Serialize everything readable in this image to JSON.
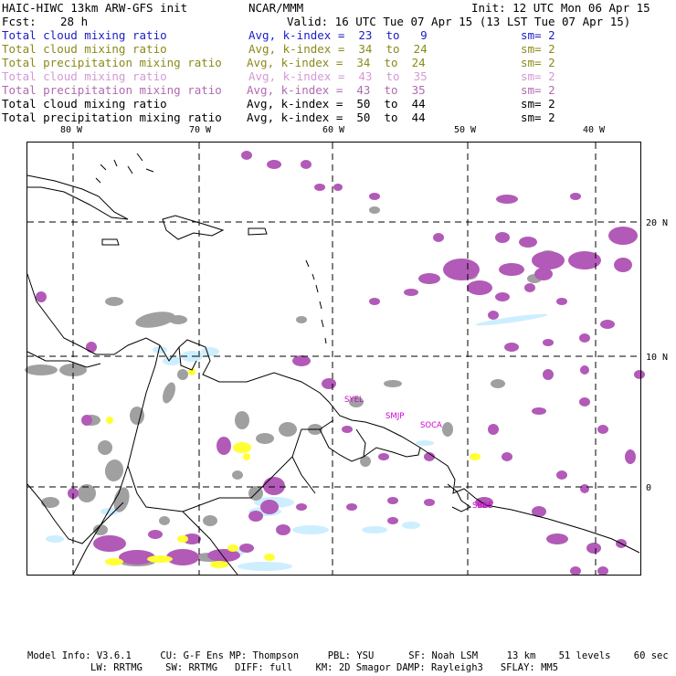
{
  "header": {
    "model": "HAIC-HIWC 13km ARW-GFS init",
    "org": "NCAR/MMM",
    "init": "Init: 12 UTC Mon 06 Apr 15",
    "fcst_label": "Fcst:",
    "fcst_value": "28 h",
    "valid": "Valid: 16 UTC Tue 07 Apr 15 (13 LST Tue 07 Apr 15)"
  },
  "fields": [
    {
      "name": "Total cloud mixing ratio",
      "avg": "Avg, k-index =  23  to   9",
      "sm": "sm= 2",
      "color": "#1c1cc8"
    },
    {
      "name": "Total cloud mixing ratio",
      "avg": "Avg, k-index =  34  to  24",
      "sm": "sm= 2",
      "color": "#8a8a1a"
    },
    {
      "name": "Total precipitation mixing ratio",
      "avg": "Avg, k-index =  34  to  24",
      "sm": "sm= 2",
      "color": "#8a8a1a"
    },
    {
      "name": "Total cloud mixing ratio",
      "avg": "Avg, k-index =  43  to  35",
      "sm": "sm= 2",
      "color": "#d49ad4"
    },
    {
      "name": "Total precipitation mixing ratio",
      "avg": "Avg, k-index =  43  to  35",
      "sm": "sm= 2",
      "color": "#b06ab0"
    },
    {
      "name": "Total cloud mixing ratio",
      "avg": "Avg, k-index =  50  to  44",
      "sm": "sm= 2",
      "color": "#000000"
    },
    {
      "name": "Total precipitation mixing ratio",
      "avg": "Avg, k-index =  50  to  44",
      "sm": "sm= 2",
      "color": "#000000"
    }
  ],
  "map": {
    "lon_labels": [
      "80 W",
      "70 W",
      "60 W",
      "50 W",
      "40 W"
    ],
    "lat_labels": [
      "20 N",
      "10 N",
      "0"
    ],
    "stations": [
      "SYEL",
      "SMJP",
      "SOCA",
      "SBBE"
    ],
    "colors": {
      "land_outline": "#000000",
      "grid": "#000000",
      "magenta": "#b25ab8",
      "gray": "#a0a0a0",
      "lightblue": "#cdeeff",
      "yellow": "#ffff33",
      "station": "#d000d0"
    }
  },
  "footer": {
    "line1": "Model Info: V3.6.1     CU: G-F Ens MP: Thompson     PBL: YSU      SF: Noah LSM     13 km    51 levels    60 sec",
    "line2": "LW: RRTMG    SW: RRTMG   DIFF: full    KM: 2D Smagor DAMP: Rayleigh3   SFLAY: MM5"
  }
}
